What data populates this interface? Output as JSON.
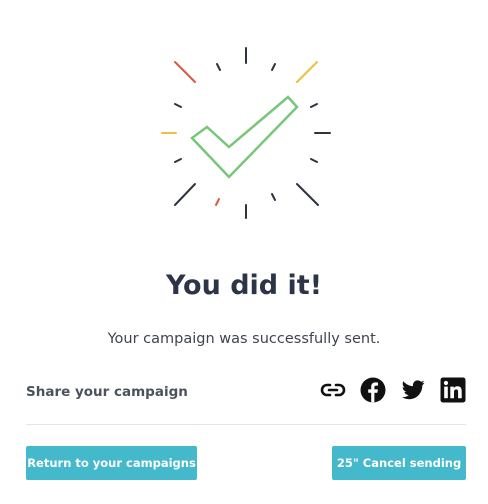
{
  "illustration": {
    "icon": "checkmark-clock-icon",
    "colors": {
      "check": "#77c67a",
      "ticks": "#2e3340",
      "accent_red": "#d95a43",
      "accent_yellow": "#f0bd45"
    }
  },
  "headline": "You did it!",
  "subtitle": "Your campaign was successfully sent.",
  "share": {
    "label": "Share your campaign",
    "icons": [
      "link-icon",
      "facebook-icon",
      "twitter-icon",
      "linkedin-icon"
    ]
  },
  "actions": {
    "return_label": "Return to your campaigns",
    "cancel_label": "25\" Cancel sending",
    "accent": "#45b9cc"
  }
}
